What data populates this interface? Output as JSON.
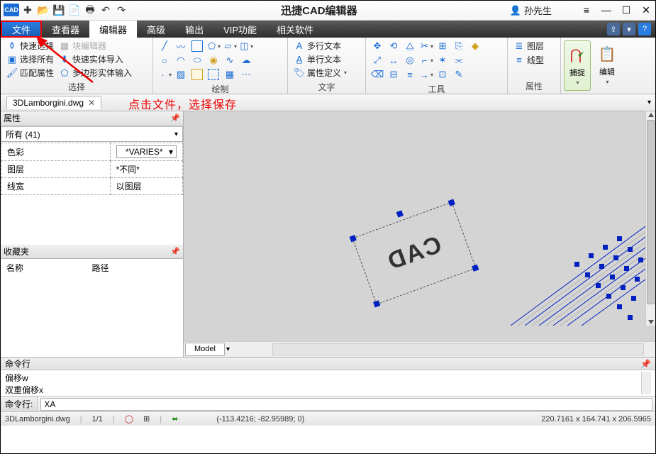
{
  "app": {
    "title": "迅捷CAD编辑器",
    "user": "孙先生"
  },
  "menu": {
    "file": "文件",
    "viewer": "查看器",
    "editor": "编辑器",
    "advanced": "高级",
    "output": "输出",
    "vip": "VIP功能",
    "related": "相关软件"
  },
  "ribbon_select": {
    "quick_select": "快速选择",
    "block_editor": "块编辑器",
    "select_all": "选择所有",
    "quick_import": "快速实体导入",
    "match_props": "匹配属性",
    "poly_input": "多边形实体输入",
    "group": "选择"
  },
  "ribbon_draw": {
    "group": "绘制"
  },
  "ribbon_text": {
    "mtext": "多行文本",
    "stext": "单行文本",
    "attdef": "属性定义",
    "group": "文字"
  },
  "ribbon_tools": {
    "group": "工具"
  },
  "ribbon_props": {
    "layer": "图层",
    "linetype": "线型",
    "group": "属性"
  },
  "ribbon_big": {
    "snap": "捕捉",
    "edit": "编辑"
  },
  "doc": {
    "tab": "3DLamborgini.dwg"
  },
  "annotation": "点击文件，选择保存",
  "props_panel": {
    "title": "属性",
    "filter": "所有 (41)",
    "color": "色彩",
    "color_val": "*VARIES*",
    "layer": "图层",
    "layer_val": "*不同*",
    "lweight": "线宽",
    "lweight_val": "以图层"
  },
  "fav_panel": {
    "title": "收藏夹",
    "col1": "名称",
    "col2": "路径"
  },
  "canvas": {
    "model_tab": "Model",
    "watermark": "CAD"
  },
  "cmd": {
    "title": "命令行",
    "line1": "偏移w",
    "line2": "双重偏移x",
    "prompt": "命令行:",
    "input": "XA"
  },
  "status": {
    "file": "3DLamborgini.dwg",
    "page": "1/1",
    "coords": "(-113.4216; -82.95989; 0)",
    "size": "220.7161 x 164.741 x 206.5965"
  }
}
